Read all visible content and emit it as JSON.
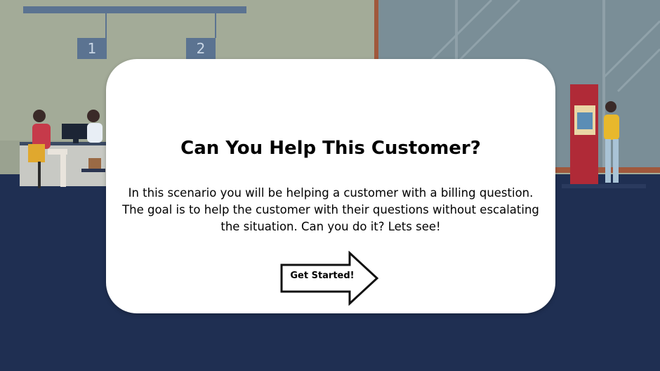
{
  "window": {
    "counter_numbers": [
      "1",
      "2"
    ]
  },
  "modal": {
    "title": "Can You Help This Customer?",
    "body": "In this scenario you will be helping a customer with a billing question. The goal is to help the customer with their questions without escalating the situation. Can you do it? Lets see!",
    "button_label": "Get Started!"
  },
  "colors": {
    "floor": "#1f2f52",
    "wall": "#a3ab98",
    "window_glass": "#7a8e97",
    "counter_sign": "#5b7391",
    "atm": "#b02a37",
    "card": "#ffffff"
  },
  "icons": {
    "start": "arrow-right-icon"
  }
}
